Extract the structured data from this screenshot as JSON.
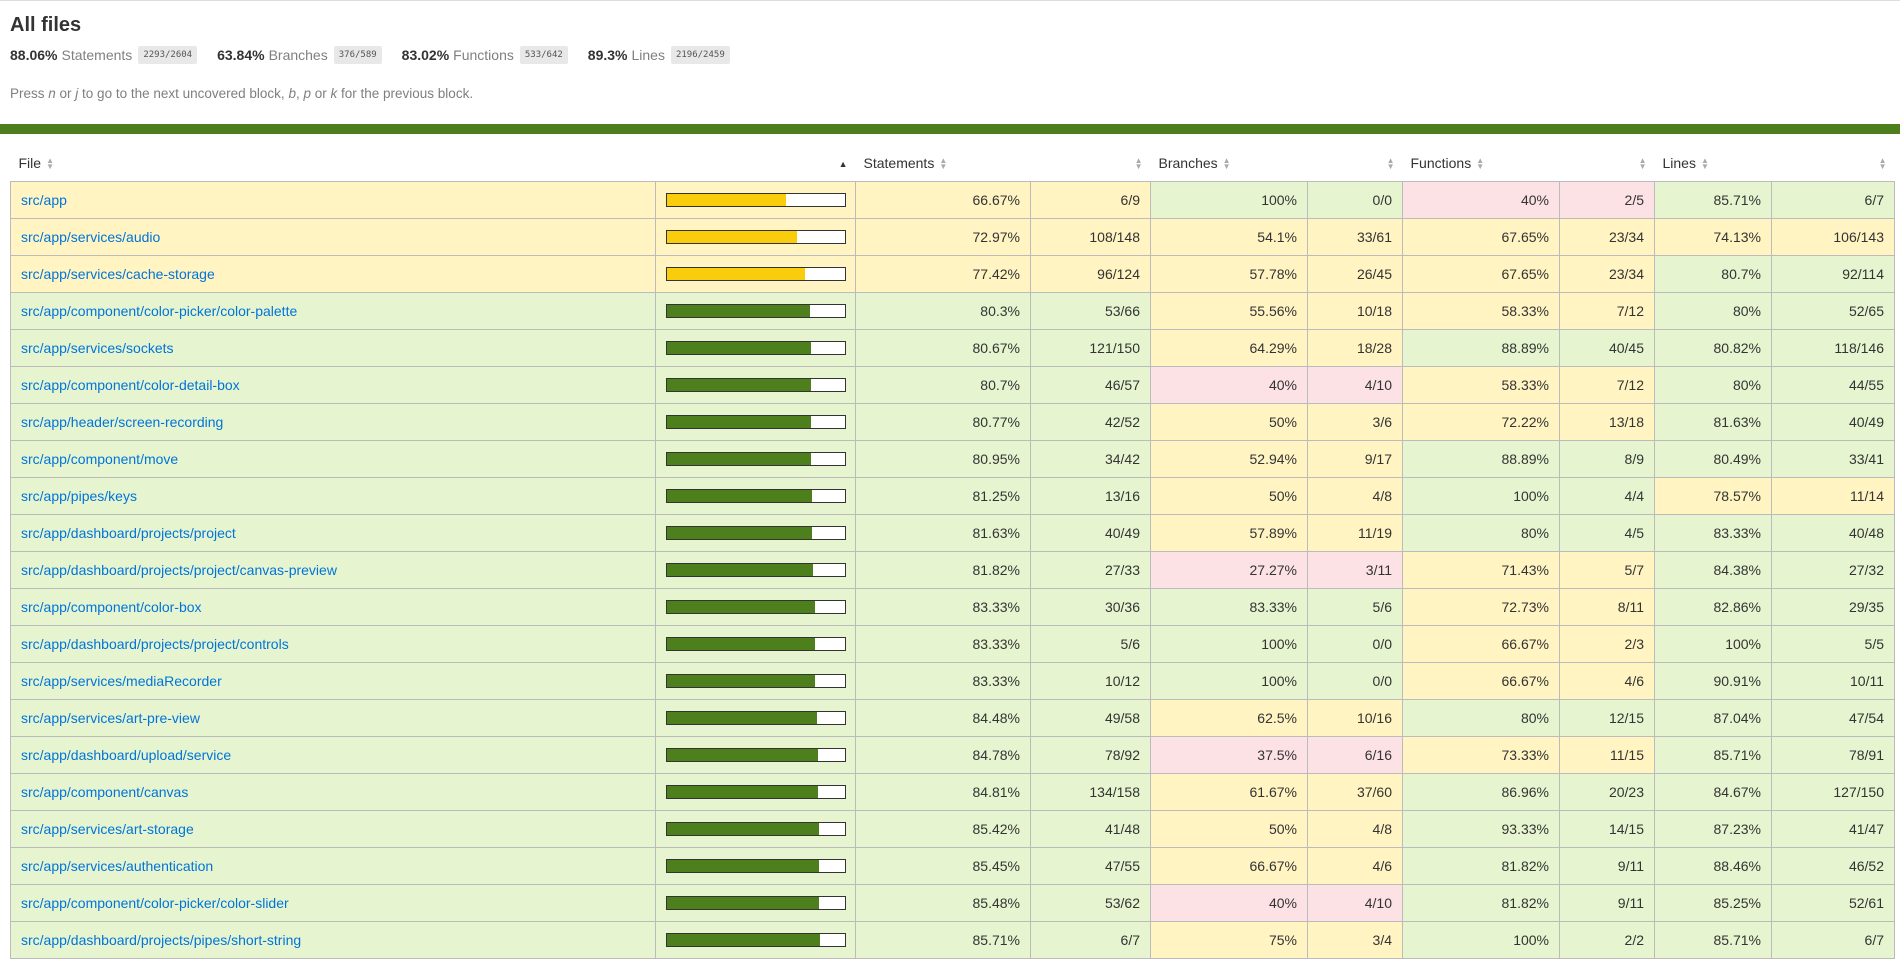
{
  "page": {
    "title": "All files",
    "summary": [
      {
        "pct": "88.06%",
        "label": "Statements",
        "fraction": "2293/2604"
      },
      {
        "pct": "63.84%",
        "label": "Branches",
        "fraction": "376/589"
      },
      {
        "pct": "83.02%",
        "label": "Functions",
        "fraction": "533/642"
      },
      {
        "pct": "89.3%",
        "label": "Lines",
        "fraction": "2196/2459"
      }
    ],
    "hint": {
      "p1": "Press ",
      "n": "n",
      "p2": " or ",
      "j": "j",
      "p3": " to go to the next uncovered block, ",
      "b": "b",
      "p4": ", ",
      "p": "p",
      "p5": " or ",
      "k": "k",
      "p6": " for the previous block."
    }
  },
  "table": {
    "headers": {
      "file": "File",
      "statements": "Statements",
      "branches": "Branches",
      "functions": "Functions",
      "lines": "Lines"
    },
    "rows": [
      {
        "file": "src/app",
        "bar": 0.6667,
        "st": "66.67%",
        "stf": "6/9",
        "br": "100%",
        "brf": "0/0",
        "fn": "40%",
        "fnf": "2/5",
        "ln": "85.71%",
        "lnf": "6/7",
        "c": [
          "medium",
          "high",
          "low",
          "high"
        ]
      },
      {
        "file": "src/app/services/audio",
        "bar": 0.7297,
        "st": "72.97%",
        "stf": "108/148",
        "br": "54.1%",
        "brf": "33/61",
        "fn": "67.65%",
        "fnf": "23/34",
        "ln": "74.13%",
        "lnf": "106/143",
        "c": [
          "medium",
          "medium",
          "medium",
          "medium"
        ]
      },
      {
        "file": "src/app/services/cache-storage",
        "bar": 0.7742,
        "st": "77.42%",
        "stf": "96/124",
        "br": "57.78%",
        "brf": "26/45",
        "fn": "67.65%",
        "fnf": "23/34",
        "ln": "80.7%",
        "lnf": "92/114",
        "c": [
          "medium",
          "medium",
          "medium",
          "high"
        ]
      },
      {
        "file": "src/app/component/color-picker/color-palette",
        "bar": 0.803,
        "st": "80.3%",
        "stf": "53/66",
        "br": "55.56%",
        "brf": "10/18",
        "fn": "58.33%",
        "fnf": "7/12",
        "ln": "80%",
        "lnf": "52/65",
        "c": [
          "high",
          "medium",
          "medium",
          "high"
        ]
      },
      {
        "file": "src/app/services/sockets",
        "bar": 0.8067,
        "st": "80.67%",
        "stf": "121/150",
        "br": "64.29%",
        "brf": "18/28",
        "fn": "88.89%",
        "fnf": "40/45",
        "ln": "80.82%",
        "lnf": "118/146",
        "c": [
          "high",
          "medium",
          "high",
          "high"
        ]
      },
      {
        "file": "src/app/component/color-detail-box",
        "bar": 0.807,
        "st": "80.7%",
        "stf": "46/57",
        "br": "40%",
        "brf": "4/10",
        "fn": "58.33%",
        "fnf": "7/12",
        "ln": "80%",
        "lnf": "44/55",
        "c": [
          "high",
          "low",
          "medium",
          "high"
        ]
      },
      {
        "file": "src/app/header/screen-recording",
        "bar": 0.8077,
        "st": "80.77%",
        "stf": "42/52",
        "br": "50%",
        "brf": "3/6",
        "fn": "72.22%",
        "fnf": "13/18",
        "ln": "81.63%",
        "lnf": "40/49",
        "c": [
          "high",
          "medium",
          "medium",
          "high"
        ]
      },
      {
        "file": "src/app/component/move",
        "bar": 0.8095,
        "st": "80.95%",
        "stf": "34/42",
        "br": "52.94%",
        "brf": "9/17",
        "fn": "88.89%",
        "fnf": "8/9",
        "ln": "80.49%",
        "lnf": "33/41",
        "c": [
          "high",
          "medium",
          "high",
          "high"
        ]
      },
      {
        "file": "src/app/pipes/keys",
        "bar": 0.8125,
        "st": "81.25%",
        "stf": "13/16",
        "br": "50%",
        "brf": "4/8",
        "fn": "100%",
        "fnf": "4/4",
        "ln": "78.57%",
        "lnf": "11/14",
        "c": [
          "high",
          "medium",
          "high",
          "medium"
        ]
      },
      {
        "file": "src/app/dashboard/projects/project",
        "bar": 0.8163,
        "st": "81.63%",
        "stf": "40/49",
        "br": "57.89%",
        "brf": "11/19",
        "fn": "80%",
        "fnf": "4/5",
        "ln": "83.33%",
        "lnf": "40/48",
        "c": [
          "high",
          "medium",
          "high",
          "high"
        ]
      },
      {
        "file": "src/app/dashboard/projects/project/canvas-preview",
        "bar": 0.8182,
        "st": "81.82%",
        "stf": "27/33",
        "br": "27.27%",
        "brf": "3/11",
        "fn": "71.43%",
        "fnf": "5/7",
        "ln": "84.38%",
        "lnf": "27/32",
        "c": [
          "high",
          "low",
          "medium",
          "high"
        ]
      },
      {
        "file": "src/app/component/color-box",
        "bar": 0.8333,
        "st": "83.33%",
        "stf": "30/36",
        "br": "83.33%",
        "brf": "5/6",
        "fn": "72.73%",
        "fnf": "8/11",
        "ln": "82.86%",
        "lnf": "29/35",
        "c": [
          "high",
          "high",
          "medium",
          "high"
        ]
      },
      {
        "file": "src/app/dashboard/projects/project/controls",
        "bar": 0.8333,
        "st": "83.33%",
        "stf": "5/6",
        "br": "100%",
        "brf": "0/0",
        "fn": "66.67%",
        "fnf": "2/3",
        "ln": "100%",
        "lnf": "5/5",
        "c": [
          "high",
          "high",
          "medium",
          "high"
        ]
      },
      {
        "file": "src/app/services/mediaRecorder",
        "bar": 0.8333,
        "st": "83.33%",
        "stf": "10/12",
        "br": "100%",
        "brf": "0/0",
        "fn": "66.67%",
        "fnf": "4/6",
        "ln": "90.91%",
        "lnf": "10/11",
        "c": [
          "high",
          "high",
          "medium",
          "high"
        ]
      },
      {
        "file": "src/app/services/art-pre-view",
        "bar": 0.8448,
        "st": "84.48%",
        "stf": "49/58",
        "br": "62.5%",
        "brf": "10/16",
        "fn": "80%",
        "fnf": "12/15",
        "ln": "87.04%",
        "lnf": "47/54",
        "c": [
          "high",
          "medium",
          "high",
          "high"
        ]
      },
      {
        "file": "src/app/dashboard/upload/service",
        "bar": 0.8478,
        "st": "84.78%",
        "stf": "78/92",
        "br": "37.5%",
        "brf": "6/16",
        "fn": "73.33%",
        "fnf": "11/15",
        "ln": "85.71%",
        "lnf": "78/91",
        "c": [
          "high",
          "low",
          "medium",
          "high"
        ]
      },
      {
        "file": "src/app/component/canvas",
        "bar": 0.8481,
        "st": "84.81%",
        "stf": "134/158",
        "br": "61.67%",
        "brf": "37/60",
        "fn": "86.96%",
        "fnf": "20/23",
        "ln": "84.67%",
        "lnf": "127/150",
        "c": [
          "high",
          "medium",
          "high",
          "high"
        ]
      },
      {
        "file": "src/app/services/art-storage",
        "bar": 0.8542,
        "st": "85.42%",
        "stf": "41/48",
        "br": "50%",
        "brf": "4/8",
        "fn": "93.33%",
        "fnf": "14/15",
        "ln": "87.23%",
        "lnf": "41/47",
        "c": [
          "high",
          "medium",
          "high",
          "high"
        ]
      },
      {
        "file": "src/app/services/authentication",
        "bar": 0.8545,
        "st": "85.45%",
        "stf": "47/55",
        "br": "66.67%",
        "brf": "4/6",
        "fn": "81.82%",
        "fnf": "9/11",
        "ln": "88.46%",
        "lnf": "46/52",
        "c": [
          "high",
          "medium",
          "high",
          "high"
        ]
      },
      {
        "file": "src/app/component/color-picker/color-slider",
        "bar": 0.8548,
        "st": "85.48%",
        "stf": "53/62",
        "br": "40%",
        "brf": "4/10",
        "fn": "81.82%",
        "fnf": "9/11",
        "ln": "85.25%",
        "lnf": "52/61",
        "c": [
          "high",
          "low",
          "high",
          "high"
        ]
      },
      {
        "file": "src/app/dashboard/projects/pipes/short-string",
        "bar": 0.8571,
        "st": "85.71%",
        "stf": "6/7",
        "br": "75%",
        "brf": "3/4",
        "fn": "100%",
        "fnf": "2/2",
        "ln": "85.71%",
        "lnf": "6/7",
        "c": [
          "high",
          "medium",
          "high",
          "high"
        ]
      }
    ]
  },
  "colors": {
    "high": "#e6f5d0",
    "medium": "#fff4c2",
    "low": "#fce1e5",
    "bar_green": "#4d7f1d",
    "bar_yellow": "#f9cd0b",
    "link": "#0074d9"
  }
}
